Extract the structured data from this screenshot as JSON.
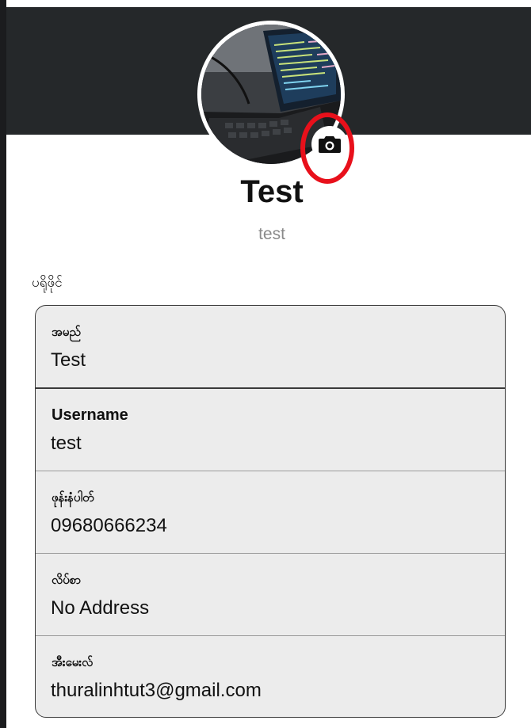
{
  "profile": {
    "display_name": "Test",
    "username": "test"
  },
  "camera_button": {
    "icon": "camera-icon"
  },
  "section": {
    "title": "ပရိုဖိုင်"
  },
  "fields": [
    {
      "label": "အမည်",
      "value": "Test"
    },
    {
      "label": "Username",
      "value": "test"
    },
    {
      "label": "ဖုန်းနံပါတ်",
      "value": "09680666234"
    },
    {
      "label": "လိပ်စာ",
      "value": "No Address"
    },
    {
      "label": "အီးမေးလ်",
      "value": "thuralinhtut3@gmail.com"
    }
  ],
  "colors": {
    "header": "#25282a",
    "card": "#ececec",
    "highlight": "#e8101b"
  }
}
